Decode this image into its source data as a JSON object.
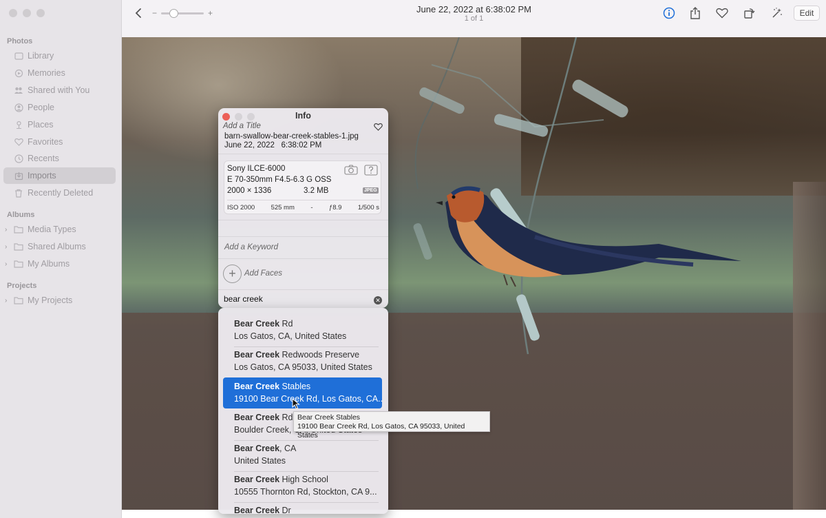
{
  "sidebar": {
    "section_photos": "Photos",
    "items": [
      {
        "label": "Library",
        "icon": "library-icon"
      },
      {
        "label": "Memories",
        "icon": "memories-icon"
      },
      {
        "label": "Shared with You",
        "icon": "shared-with-you-icon"
      },
      {
        "label": "People",
        "icon": "people-icon"
      },
      {
        "label": "Places",
        "icon": "places-icon"
      },
      {
        "label": "Favorites",
        "icon": "heart-icon"
      },
      {
        "label": "Recents",
        "icon": "clock-icon"
      },
      {
        "label": "Imports",
        "icon": "imports-icon"
      },
      {
        "label": "Recently Deleted",
        "icon": "trash-icon"
      }
    ],
    "section_albums": "Albums",
    "albums": [
      {
        "label": "Media Types"
      },
      {
        "label": "Shared Albums"
      },
      {
        "label": "My Albums"
      }
    ],
    "section_projects": "Projects",
    "projects": [
      {
        "label": "My Projects"
      }
    ]
  },
  "toolbar": {
    "title": "June 22, 2022 at 6:38:02 PM",
    "subtitle": "1 of 1",
    "zoom_minus": "−",
    "zoom_plus": "+",
    "zoom_level": 0.25,
    "edit_label": "Edit"
  },
  "info": {
    "title": "Info",
    "add_title_placeholder": "Add a Title",
    "filename": "barn-swallow-bear-creek-stables-1.jpg",
    "date": "June 22, 2022",
    "time": "6:38:02 PM",
    "camera": "Sony ILCE-6000",
    "lens": "E 70-350mm F4.5-6.3 G OSS",
    "dimensions": "2000 × 1336",
    "filesize": "3.2 MB",
    "format": "JPEG",
    "iso": "ISO 2000",
    "focal": "525 mm",
    "ev": "-",
    "aperture": "ƒ8.9",
    "shutter": "1/500 s",
    "keyword_placeholder": "Add a Keyword",
    "faces_label": "Add Faces",
    "location_value": "bear creek"
  },
  "suggestions": [
    {
      "bold": "Bear Creek",
      "rest": " Rd",
      "line2": "Los Gatos, CA, United States",
      "selected": false
    },
    {
      "bold": "Bear Creek",
      "rest": " Redwoods Preserve",
      "line2": "Los Gatos, CA 95033, United States",
      "selected": false
    },
    {
      "bold": "Bear Creek",
      "rest": " Stables",
      "line2": "19100 Bear Creek Rd, Los Gatos, CA...",
      "selected": true
    },
    {
      "bold": "Bear Creek",
      "rest": " Rd",
      "line2": "Boulder Creek, CA, United States",
      "selected": false
    },
    {
      "bold": "Bear Creek",
      "rest": ", CA",
      "line2": "United States",
      "selected": false
    },
    {
      "bold": "Bear Creek",
      "rest": " High School",
      "line2": "10555 Thornton Rd, Stockton, CA  9...",
      "selected": false
    },
    {
      "bold": "Bear Creek",
      "rest": " Dr",
      "line2": "",
      "selected": false
    }
  ],
  "tooltip": {
    "line1": "Bear Creek Stables",
    "line2": "19100 Bear Creek Rd, Los Gatos, CA  95033, United States"
  },
  "colors": {
    "accent": "#1f6fd8",
    "close": "#ec5f58",
    "info_icon": "#1f6fd8"
  }
}
